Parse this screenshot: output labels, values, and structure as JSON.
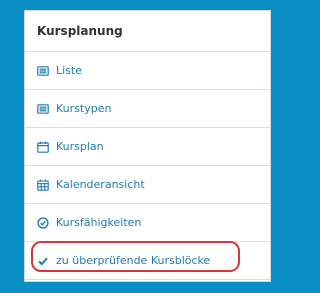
{
  "colors": {
    "background": "#0a8fc4",
    "link": "#1f7bb6",
    "highlight": "#d43a3a"
  },
  "panel": {
    "title": "Kursplanung",
    "items": [
      {
        "label": "Liste",
        "icon": "list-icon"
      },
      {
        "label": "Kurstypen",
        "icon": "list-icon"
      },
      {
        "label": "Kursplan",
        "icon": "calendar-icon"
      },
      {
        "label": "Kalenderansicht",
        "icon": "calendar-grid-icon"
      },
      {
        "label": "Kursfähigkeiten",
        "icon": "check-circle-icon"
      },
      {
        "label": "zu überprüfende Kursblöcke",
        "icon": "check-icon"
      }
    ]
  }
}
